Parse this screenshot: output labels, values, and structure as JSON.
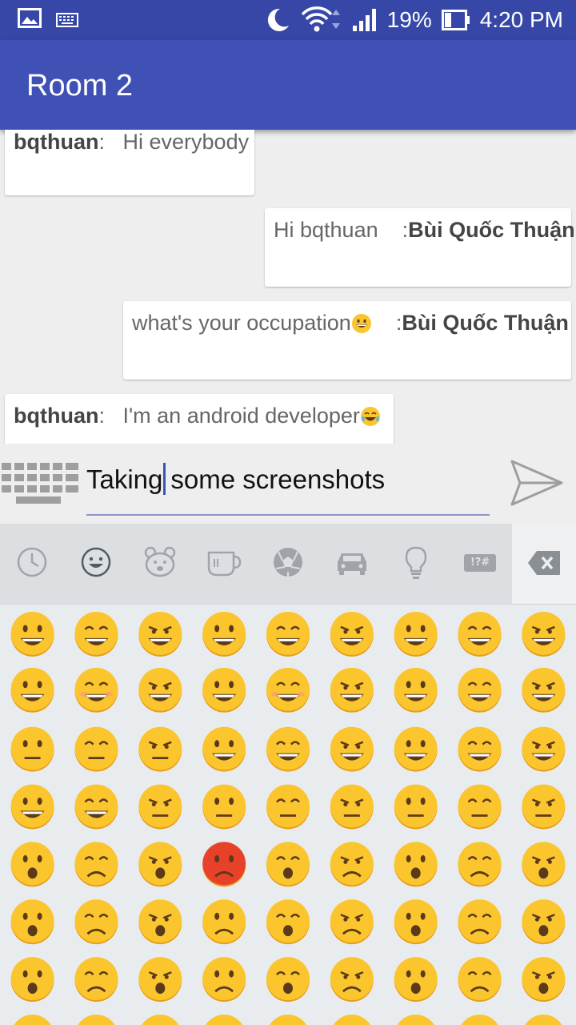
{
  "status_bar": {
    "battery": "19%",
    "time": "4:20 PM"
  },
  "app_bar": {
    "title": "Room 2"
  },
  "messages": [
    {
      "side": "left",
      "sender": "bqthuan",
      "separator": ":",
      "text": "Hi everybody",
      "emoji": ""
    },
    {
      "side": "right",
      "sender": "Bùi Quốc Thuận",
      "separator": ":",
      "text": "Hi bqthuan",
      "emoji": ""
    },
    {
      "side": "right",
      "sender": "Bùi Quốc Thuận",
      "separator": ":",
      "text": "what's your occupation",
      "emoji": "grinning-face"
    },
    {
      "side": "left",
      "sender": "bqthuan",
      "separator": ":",
      "text": "I'm an android developer",
      "emoji": "tears-of-joy-face"
    }
  ],
  "input": {
    "value_before_caret": "Taking",
    "value_after_caret": "some screenshots"
  },
  "emoji_keyboard": {
    "tabs": [
      "recent-icon",
      "smileys-icon",
      "animals-icon",
      "food-icon",
      "sports-icon",
      "travel-icon",
      "objects-icon",
      "symbols-icon"
    ],
    "symbols_tab_label": "!?#",
    "colors": {
      "face": "#fbc52d",
      "face_dark": "#e89c1a",
      "feature": "#5b3a1a",
      "angry": "#e8412a",
      "blush": "#f2a07a"
    }
  }
}
